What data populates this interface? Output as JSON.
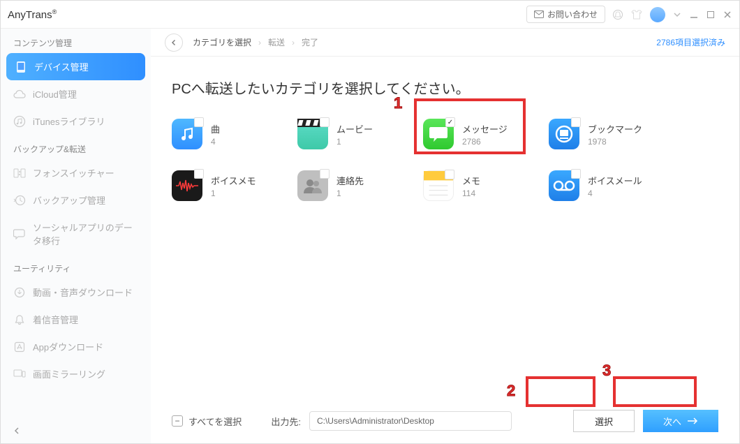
{
  "app_title": "AnyTrans",
  "contact_label": "お問い合わせ",
  "sidebar": {
    "sections": [
      {
        "title": "コンテンツ管理"
      },
      {
        "title": "バックアップ&転送"
      },
      {
        "title": "ユーティリティ"
      }
    ],
    "items": [
      {
        "label": "デバイス管理"
      },
      {
        "label": "iCloud管理"
      },
      {
        "label": "iTunesライブラリ"
      },
      {
        "label": "フォンスイッチャー"
      },
      {
        "label": "バックアップ管理"
      },
      {
        "label": "ソーシャルアプリのデータ移行"
      },
      {
        "label": "動画・音声ダウンロード"
      },
      {
        "label": "着信音管理"
      },
      {
        "label": "Appダウンロード"
      },
      {
        "label": "画面ミラーリング"
      }
    ]
  },
  "breadcrumb": {
    "step1": "カテゴリを選択",
    "step2": "転送",
    "step3": "完了",
    "status": "2786項目選択済み"
  },
  "headline": "PCへ転送したいカテゴリを選択してください。",
  "categories": [
    {
      "name": "曲",
      "count": "4"
    },
    {
      "name": "ムービー",
      "count": "1"
    },
    {
      "name": "メッセージ",
      "count": "2786"
    },
    {
      "name": "ブックマーク",
      "count": "1978"
    },
    {
      "name": "ボイスメモ",
      "count": "1"
    },
    {
      "name": "連絡先",
      "count": "1"
    },
    {
      "name": "メモ",
      "count": "114"
    },
    {
      "name": "ボイスメール",
      "count": "4"
    }
  ],
  "bottom": {
    "select_all": "すべてを選択",
    "output_label": "出力先:",
    "output_path": "C:\\Users\\Administrator\\Desktop",
    "choose": "選択",
    "next": "次へ"
  },
  "annotations": {
    "one": "1",
    "two": "2",
    "three": "3"
  }
}
